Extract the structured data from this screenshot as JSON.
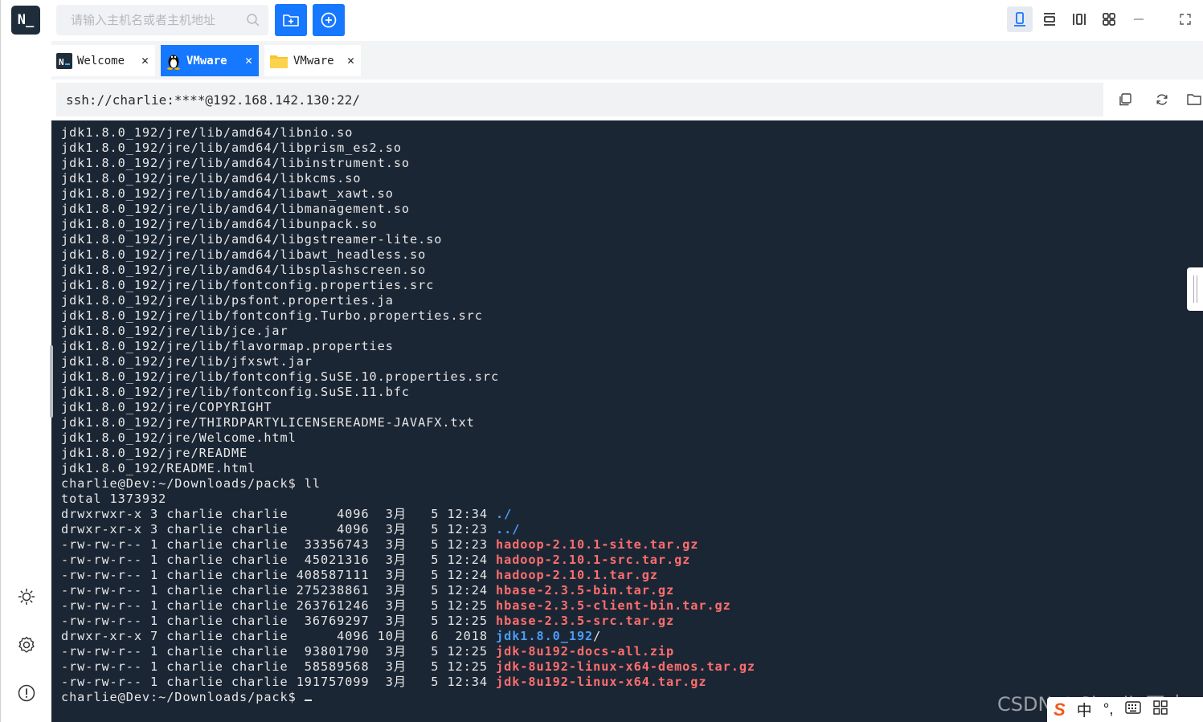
{
  "app": {
    "logo_text": "N_"
  },
  "search": {
    "placeholder": "请输入主机名或者主机地址"
  },
  "tabs": [
    {
      "label": "Welcome",
      "icon": "app-logo-icon",
      "close": "✕"
    },
    {
      "label": "VMware",
      "icon": "linux-tux-icon",
      "close": "✕"
    },
    {
      "label": "VMware",
      "icon": "folder-icon",
      "close": "✕"
    }
  ],
  "address": {
    "value": "ssh://charlie:****@192.168.142.130:22/"
  },
  "terminal": {
    "lines": [
      "jdk1.8.0_192/jre/lib/amd64/libnio.so",
      "jdk1.8.0_192/jre/lib/amd64/libprism_es2.so",
      "jdk1.8.0_192/jre/lib/amd64/libinstrument.so",
      "jdk1.8.0_192/jre/lib/amd64/libkcms.so",
      "jdk1.8.0_192/jre/lib/amd64/libawt_xawt.so",
      "jdk1.8.0_192/jre/lib/amd64/libmanagement.so",
      "jdk1.8.0_192/jre/lib/amd64/libunpack.so",
      "jdk1.8.0_192/jre/lib/amd64/libgstreamer-lite.so",
      "jdk1.8.0_192/jre/lib/amd64/libawt_headless.so",
      "jdk1.8.0_192/jre/lib/amd64/libsplashscreen.so",
      "jdk1.8.0_192/jre/lib/fontconfig.properties.src",
      "jdk1.8.0_192/jre/lib/psfont.properties.ja",
      "jdk1.8.0_192/jre/lib/fontconfig.Turbo.properties.src",
      "jdk1.8.0_192/jre/lib/jce.jar",
      "jdk1.8.0_192/jre/lib/flavormap.properties",
      "jdk1.8.0_192/jre/lib/jfxswt.jar",
      "jdk1.8.0_192/jre/lib/fontconfig.SuSE.10.properties.src",
      "jdk1.8.0_192/jre/lib/fontconfig.SuSE.11.bfc",
      "jdk1.8.0_192/jre/COPYRIGHT",
      "jdk1.8.0_192/jre/THIRDPARTYLICENSEREADME-JAVAFX.txt",
      "jdk1.8.0_192/jre/Welcome.html",
      "jdk1.8.0_192/jre/README",
      "jdk1.8.0_192/README.html",
      "charlie@Dev:~/Downloads/pack$ ll",
      "total 1373932"
    ],
    "listing": [
      {
        "meta": "drwxrwxr-x 3 charlie charlie      4096  3月   5 12:34 ",
        "name": "./",
        "name_color": "blue",
        "suffix": ""
      },
      {
        "meta": "drwxr-xr-x 3 charlie charlie      4096  3月   5 12:23 ",
        "name": "../",
        "name_color": "blue",
        "suffix": ""
      },
      {
        "meta": "-rw-rw-r-- 1 charlie charlie  33356743  3月   5 12:23 ",
        "name": "hadoop-2.10.1-site.tar.gz",
        "name_color": "red",
        "suffix": ""
      },
      {
        "meta": "-rw-rw-r-- 1 charlie charlie  45021316  3月   5 12:24 ",
        "name": "hadoop-2.10.1-src.tar.gz",
        "name_color": "red",
        "suffix": ""
      },
      {
        "meta": "-rw-rw-r-- 1 charlie charlie 408587111  3月   5 12:24 ",
        "name": "hadoop-2.10.1.tar.gz",
        "name_color": "red",
        "suffix": ""
      },
      {
        "meta": "-rw-rw-r-- 1 charlie charlie 275238861  3月   5 12:24 ",
        "name": "hbase-2.3.5-bin.tar.gz",
        "name_color": "red",
        "suffix": ""
      },
      {
        "meta": "-rw-rw-r-- 1 charlie charlie 263761246  3月   5 12:25 ",
        "name": "hbase-2.3.5-client-bin.tar.gz",
        "name_color": "red",
        "suffix": ""
      },
      {
        "meta": "-rw-rw-r-- 1 charlie charlie  36769297  3月   5 12:25 ",
        "name": "hbase-2.3.5-src.tar.gz",
        "name_color": "red",
        "suffix": ""
      },
      {
        "meta": "drwxr-xr-x 7 charlie charlie      4096 10月   6  2018 ",
        "name": "jdk1.8.0_192",
        "name_color": "blue",
        "suffix": "/"
      },
      {
        "meta": "-rw-rw-r-- 1 charlie charlie  93801790  3月   5 12:25 ",
        "name": "jdk-8u192-docs-all.zip",
        "name_color": "red",
        "suffix": ""
      },
      {
        "meta": "-rw-rw-r-- 1 charlie charlie  58589568  3月   5 12:25 ",
        "name": "jdk-8u192-linux-x64-demos.tar.gz",
        "name_color": "red",
        "suffix": ""
      },
      {
        "meta": "-rw-rw-r-- 1 charlie charlie 191757099  3月   5 12:34 ",
        "name": "jdk-8u192-linux-x64.tar.gz",
        "name_color": "red",
        "suffix": ""
      }
    ],
    "prompt": "charlie@Dev:~/Downloads/pack$ "
  },
  "watermark": "CSDN @Charlie不才",
  "ime": {
    "logo": "S",
    "lang": "中",
    "punct": "°,"
  },
  "colors": {
    "accent": "#1677ff",
    "terminal_bg": "#1b2634",
    "dir_blue": "#4a9df8",
    "archive_red": "#ff6e6e"
  }
}
